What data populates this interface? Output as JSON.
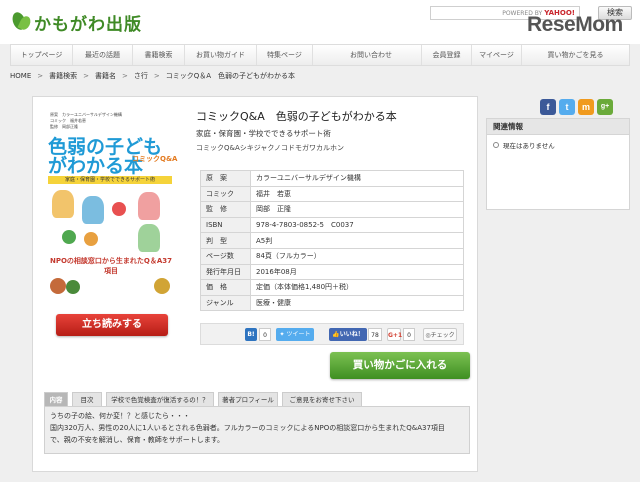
{
  "header": {
    "logo_text": "かもがわ出版",
    "search_provider_prefix": "POWERED BY",
    "search_provider": "YAHOO!",
    "search_button": "検索",
    "watermark": "ReseMom"
  },
  "nav": {
    "items": [
      "トップページ",
      "最近の話題",
      "書籍検索",
      "お買い物ガイド",
      "特集ページ",
      "お問い合わせ",
      "会員登録",
      "マイページ",
      "買い物かごを見る"
    ]
  },
  "breadcrumb": [
    "HOME",
    "書籍検索",
    "書籍名",
    "さ行",
    "コミックQ＆A　色弱の子どもがわかる本"
  ],
  "cover": {
    "header_lines": [
      "原案　カラーユニバーサルデザイン機構",
      "コミック　福井若恵",
      "監修　岡部正隆"
    ],
    "title": "色弱の子どもがわかる本",
    "title_sub": "コミックQ&A",
    "band": "家庭・保育園・学校でできるサポート術",
    "npo": "NPOの相談窓口から生まれたQ＆A37項目"
  },
  "book": {
    "title": "コミックQ&A　色弱の子どもがわかる本",
    "subtitle": "家庭・保育園・学校でできるサポート術",
    "kana": "コミックQ&Aシキジャクノコドモガワカルホン",
    "preview_label": "立ち読みする",
    "info": [
      {
        "key": "原　案",
        "value": "カラーユニバーサルデザイン機構"
      },
      {
        "key": "コミック",
        "value": "福井　若恵"
      },
      {
        "key": "監　修",
        "value": "岡部　正隆"
      },
      {
        "key": "ISBN",
        "value": "978-4-7803-0852-5　C0037"
      },
      {
        "key": "判　型",
        "value": "A5判"
      },
      {
        "key": "ページ数",
        "value": "84頁（フルカラー）"
      },
      {
        "key": "発行年月日",
        "value": "2016年08月"
      },
      {
        "key": "価　格",
        "value": "定価（本体価格1,480円＋税）"
      },
      {
        "key": "ジャンル",
        "value": "医療・健康"
      }
    ],
    "share": {
      "hatena_count": "0",
      "tweet_label": "ツイート",
      "like_label": "いいね！",
      "like_count": "78",
      "gplus_count": "0",
      "check_label": "チェック"
    },
    "cart_label": "買い物かごに入れる"
  },
  "tabs": [
    "内容",
    "目次",
    "学校で色覚検査が復活するの！？",
    "著者プロフィール",
    "ご意見をお寄せ下さい"
  ],
  "content": {
    "line1": "うちの子の絵、何か変！？と感じたら・・・",
    "line2": "国内320万人、男性の20人に1人いるとされる色弱者。フルカラーのコミックによるNPOの相談窓口から生まれたQ&A37項目",
    "line3": "で、親の不安を解消し、保育・教師をサポートします。"
  },
  "sidebar": {
    "related_title": "関連情報",
    "related_item": "現在はありません"
  },
  "colors": {
    "brand_green": "#3f8a26",
    "cart_green": "#4fa42f",
    "preview_red": "#d0302a"
  }
}
